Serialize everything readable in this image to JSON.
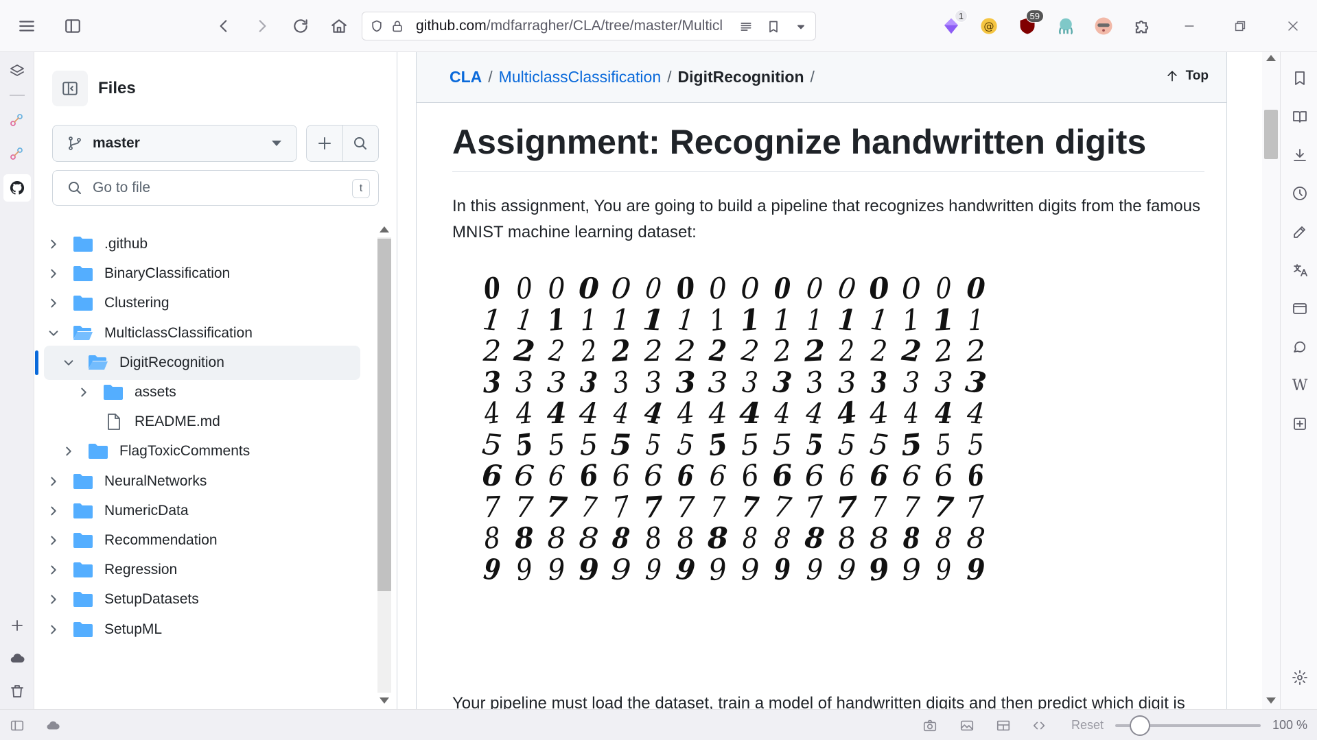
{
  "browser": {
    "url_main": "github.com",
    "url_rest": "/mdfarragher/CLA/tree/master/Multicl",
    "extensions": [
      {
        "name": "gem-extension-icon",
        "badge": "1"
      },
      {
        "name": "at-sign-extension-icon",
        "badge": ""
      },
      {
        "name": "ublock-shield-icon",
        "badge": "59"
      },
      {
        "name": "octopus-extension-icon",
        "badge": ""
      },
      {
        "name": "face-extension-icon",
        "badge": ""
      },
      {
        "name": "puzzle-extensions-icon",
        "badge": ""
      }
    ]
  },
  "files_panel": {
    "title": "Files",
    "branch": "master",
    "goto_placeholder": "Go to file",
    "goto_shortcut": "t",
    "tree": [
      {
        "label": ".github",
        "type": "folder",
        "expanded": false,
        "depth": 0
      },
      {
        "label": "BinaryClassification",
        "type": "folder",
        "expanded": false,
        "depth": 0
      },
      {
        "label": "Clustering",
        "type": "folder",
        "expanded": false,
        "depth": 0
      },
      {
        "label": "MulticlassClassification",
        "type": "folder-open",
        "expanded": true,
        "depth": 0
      },
      {
        "label": "DigitRecognition",
        "type": "folder-open",
        "expanded": true,
        "depth": 1,
        "selected": true
      },
      {
        "label": "assets",
        "type": "folder",
        "expanded": false,
        "depth": 2
      },
      {
        "label": "README.md",
        "type": "file",
        "depth": 2
      },
      {
        "label": "FlagToxicComments",
        "type": "folder",
        "expanded": false,
        "depth": 1
      },
      {
        "label": "NeuralNetworks",
        "type": "folder",
        "expanded": false,
        "depth": 0
      },
      {
        "label": "NumericData",
        "type": "folder",
        "expanded": false,
        "depth": 0
      },
      {
        "label": "Recommendation",
        "type": "folder",
        "expanded": false,
        "depth": 0
      },
      {
        "label": "Regression",
        "type": "folder",
        "expanded": false,
        "depth": 0
      },
      {
        "label": "SetupDatasets",
        "type": "folder",
        "expanded": false,
        "depth": 0
      },
      {
        "label": "SetupML",
        "type": "folder",
        "expanded": false,
        "depth": 0
      }
    ]
  },
  "breadcrumb": {
    "repo": "CLA",
    "folder": "MulticlassClassification",
    "current": "DigitRecognition",
    "sep": "/",
    "top_label": "Top"
  },
  "readme": {
    "title": "Assignment: Recognize handwritten digits",
    "intro": "In this assignment, You are going to build a pipeline that recognizes handwritten digits from the famous MNIST machine learning dataset:",
    "digit_rows": [
      "0",
      "1",
      "2",
      "3",
      "4",
      "5",
      "6",
      "7",
      "8",
      "9"
    ],
    "digits_per_row": 16,
    "next_paragraph_clip": "Your pipeline must load the dataset, train a model of handwritten digits and then predict which digit is"
  },
  "statusbar": {
    "reset_label": "Reset",
    "zoom": "100 %",
    "zoom_level_fraction": 0.17
  },
  "colors": {
    "link": "#0969da",
    "folder": "#54aeff",
    "accent_marker": "#0969da"
  }
}
